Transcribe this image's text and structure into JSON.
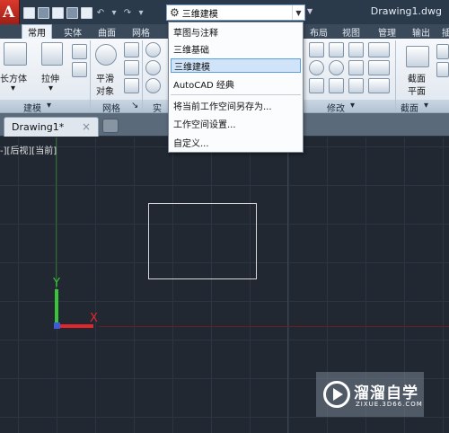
{
  "title_bar": {
    "app_button": "A",
    "workspace_current": "三维建模",
    "document_title": "Drawing1.dwg"
  },
  "ribbon_tabs": [
    "常用",
    "实体",
    "曲面",
    "网格",
    "布局",
    "视图",
    "管理",
    "输出",
    "插"
  ],
  "ribbon": {
    "box_label": "长方体",
    "extrude_label": "拉伸",
    "smooth_label_1": "平滑",
    "smooth_label_2": "对象",
    "section_label_1": "截面",
    "section_label_2": "平面",
    "panel_modeling": "建模",
    "panel_mesh": "网格",
    "panel_solid_partial": "实",
    "panel_modify": "修改",
    "panel_section": "截面"
  },
  "workspace_menu": {
    "items": [
      "草图与注释",
      "三维基础",
      "三维建模",
      "AutoCAD 经典"
    ],
    "actions": [
      "将当前工作空间另存为...",
      "工作空间设置...",
      "自定义..."
    ],
    "selected": "三维建模"
  },
  "file_tabs": {
    "drawing_tab": "Drawing1*",
    "close": "×"
  },
  "viewport": {
    "label": "-][后视][当前]",
    "ucs_x": "X",
    "ucs_y": "Y"
  },
  "watermark": {
    "title": "溜溜自学",
    "url": "ZIXUE.3D66.COM"
  },
  "colors": {
    "axis_x": "#e3262c",
    "axis_y": "#39c43a",
    "viewport_bg": "#212832",
    "selected_item": "#cfe4f8"
  }
}
